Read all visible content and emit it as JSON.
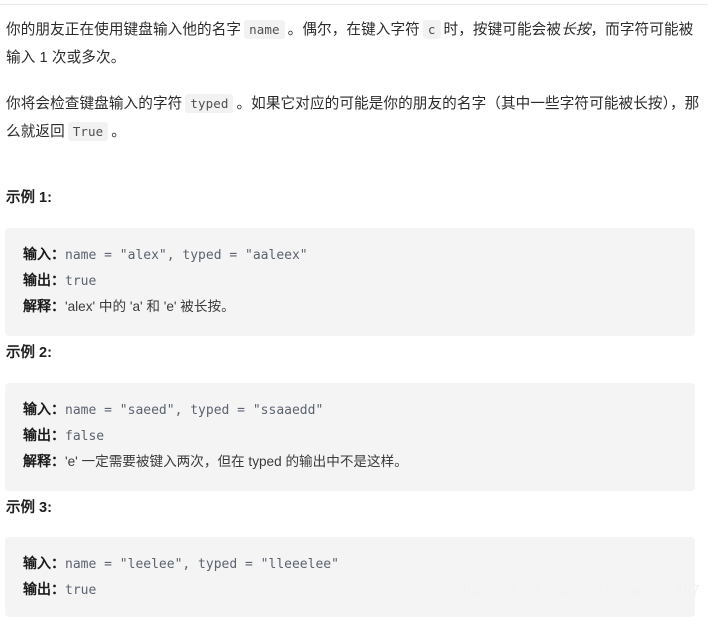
{
  "document": {
    "paragraphs": [
      {
        "id": "intro-1",
        "parts": [
          {
            "type": "text",
            "value": "你的朋友正在使用键盘输入他的名字"
          },
          {
            "type": "code",
            "value": "name"
          },
          {
            "type": "text",
            "value": "。偶尔，在键入字符"
          },
          {
            "type": "code",
            "value": "c"
          },
          {
            "type": "text",
            "value": "时，按键可能会被"
          },
          {
            "type": "italic",
            "value": "长按"
          },
          {
            "type": "text",
            "value": "，而字符可能被输入 1 次或多次。"
          }
        ]
      },
      {
        "id": "intro-2",
        "parts": [
          {
            "type": "text",
            "value": "你将会检查键盘输入的字符"
          },
          {
            "type": "code",
            "value": "typed"
          },
          {
            "type": "text",
            "value": "。如果它对应的可能是你的朋友的名字（其中一些字符可能被长按），那么就返回"
          },
          {
            "type": "code",
            "value": "True"
          },
          {
            "type": "text",
            "value": "。"
          }
        ]
      }
    ],
    "examples": [
      {
        "heading": "示例 1:",
        "lines": [
          {
            "label": "输入：",
            "code": "name = \"alex\", typed = \"aaleex\""
          },
          {
            "label": "输出：",
            "code": "true"
          },
          {
            "label": "解释：",
            "code": "'alex' 中的 'a' 和 'e' 被长按。"
          }
        ]
      },
      {
        "heading": "示例 2:",
        "lines": [
          {
            "label": "输入：",
            "code": "name = \"saeed\", typed = \"ssaaedd\""
          },
          {
            "label": "输出：",
            "code": "false"
          },
          {
            "label": "解释：",
            "code": "'e' 一定需要被键入两次，但在 typed 的输出中不是这样。"
          }
        ]
      },
      {
        "heading": "示例 3:",
        "lines": [
          {
            "label": "输入：",
            "code": "name = \"leelee\", typed = \"lleeelee\""
          },
          {
            "label": "输出：",
            "code": "true"
          }
        ]
      }
    ],
    "watermark": "https://blog.csdn.net/renweiyi1487"
  },
  "colors": {
    "page_background": "#ffffff",
    "body_text": "#2b2b2b",
    "code_block_background": "#f4f4f4",
    "inline_code_background": "#f2f2f2",
    "code_text": "#5c6370",
    "label_text": "#1a1a1a",
    "divider": "#e8e8e8",
    "watermark": "#f2f2f2"
  }
}
